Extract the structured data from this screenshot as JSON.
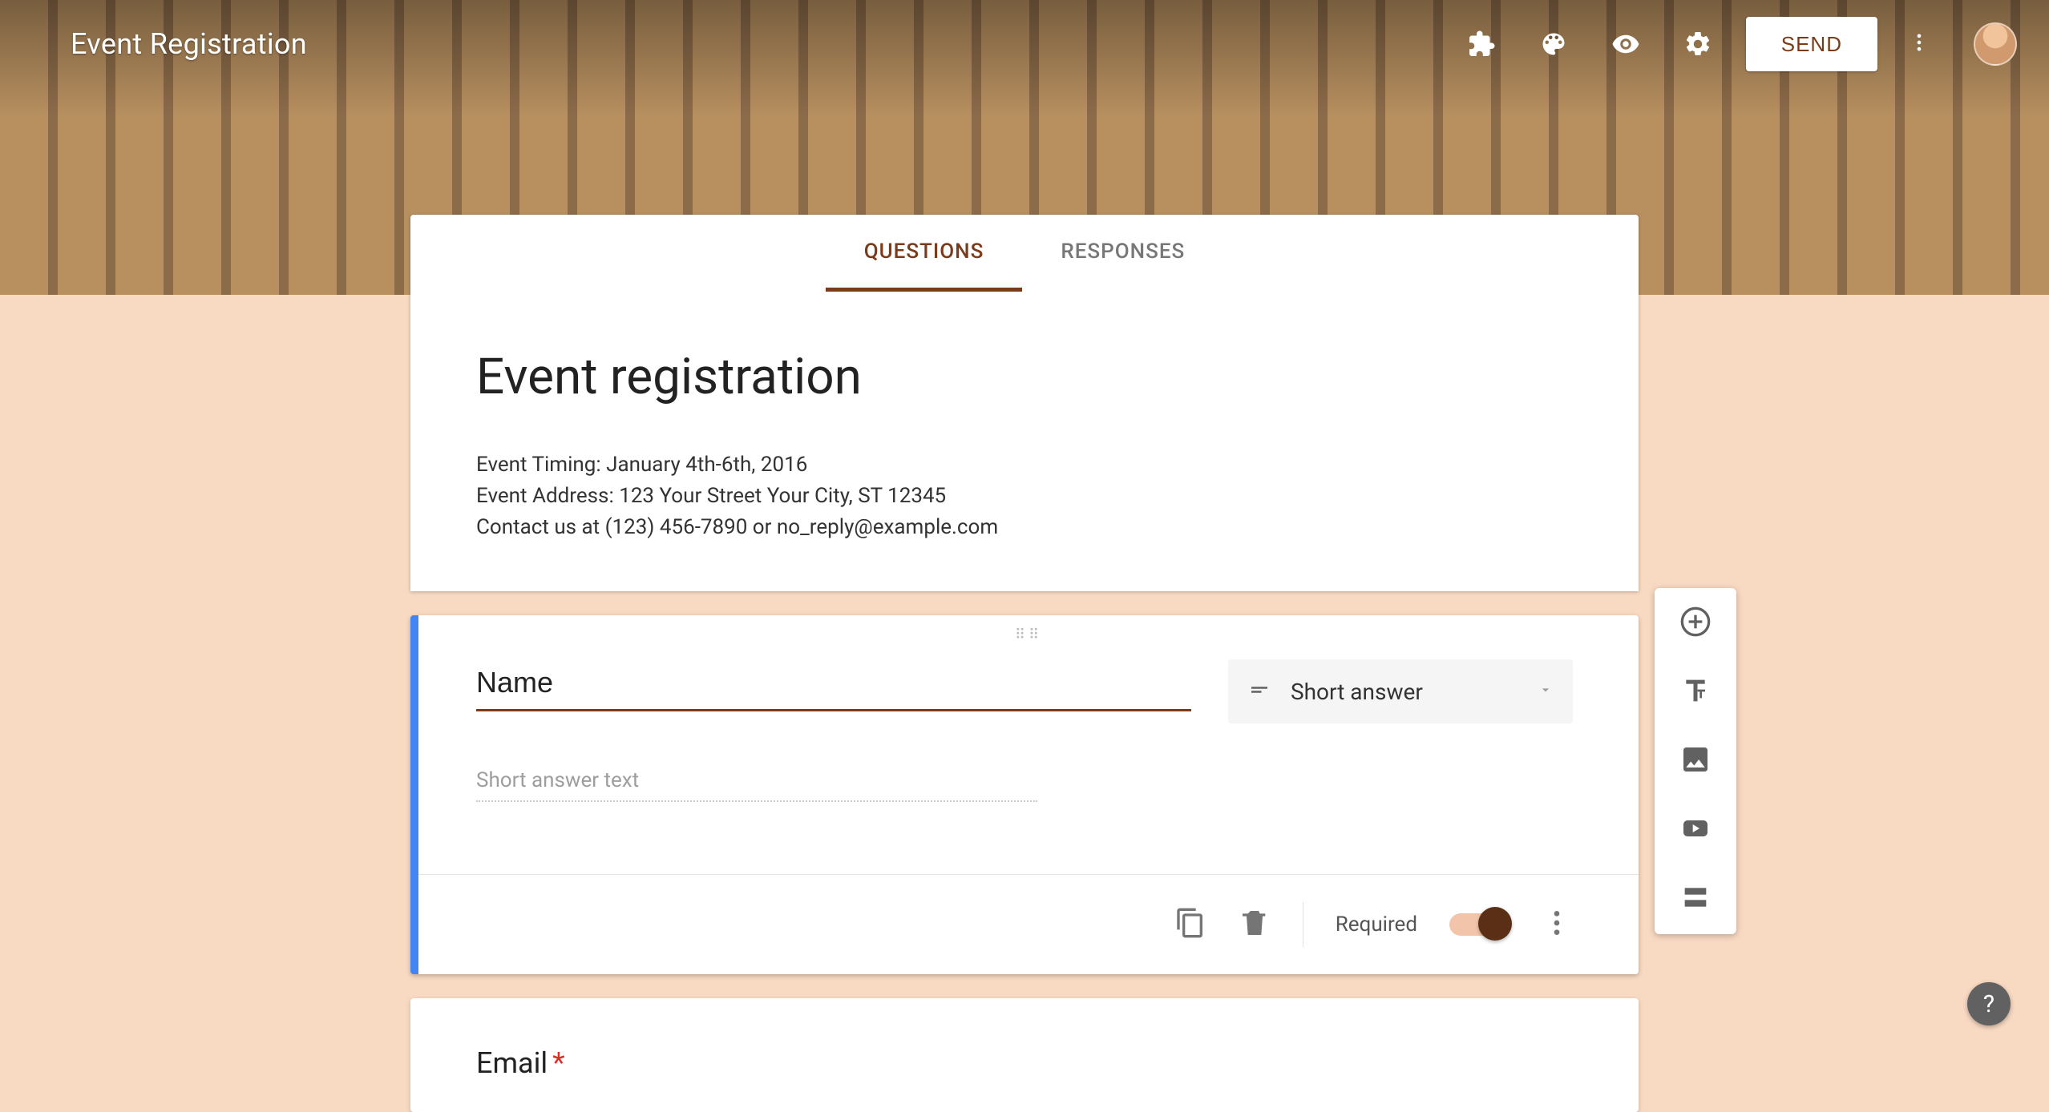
{
  "header": {
    "doc_title": "Event Registration",
    "send_label": "SEND"
  },
  "tabs": {
    "questions": "QUESTIONS",
    "responses": "RESPONSES",
    "active": "questions"
  },
  "form": {
    "title": "Event registration",
    "description": "Event Timing: January 4th-6th, 2016\nEvent Address: 123 Your Street Your City, ST 12345\nContact us at (123) 456-7890 or no_reply@example.com"
  },
  "active_question": {
    "title": "Name",
    "answer_placeholder": "Short answer text",
    "type_label": "Short answer",
    "required_label": "Required",
    "required": true
  },
  "next_question": {
    "title": "Email",
    "required": true
  },
  "side_tools": {
    "add_question": "add-question",
    "add_title": "add-title-description",
    "add_image": "add-image",
    "add_video": "add-video",
    "add_section": "add-section"
  }
}
